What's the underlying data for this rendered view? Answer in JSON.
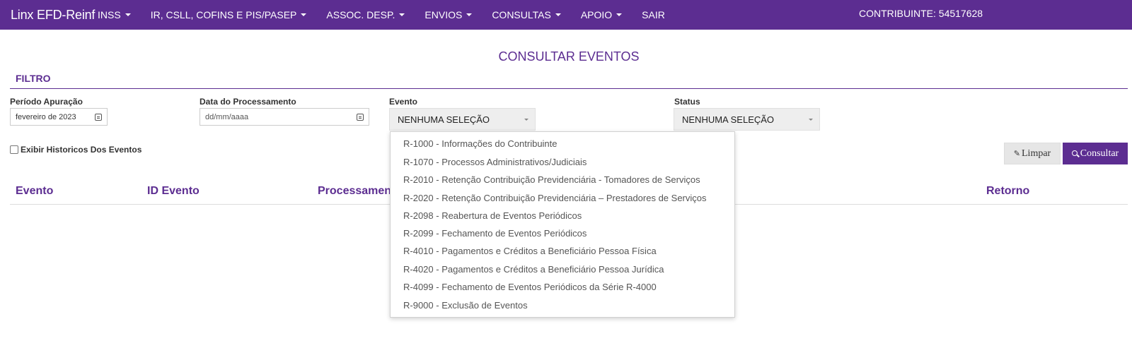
{
  "navbar": {
    "brand": "Linx EFD-Reinf",
    "menu": [
      {
        "label": "INSS"
      },
      {
        "label": "IR, CSLL, COFINS E PIS/PASEP"
      },
      {
        "label": "ASSOC. DESP."
      },
      {
        "label": "ENVIOS"
      },
      {
        "label": "CONSULTAS"
      },
      {
        "label": "APOIO"
      },
      {
        "label": "SAIR"
      }
    ],
    "contribuinte": "CONTRIBUINTE: 54517628"
  },
  "page": {
    "title": "CONSULTAR EVENTOS",
    "section_title": "FILTRO"
  },
  "filters": {
    "periodo": {
      "label": "Período Apuração",
      "value": "fevereiro de 2023"
    },
    "processamento": {
      "label": "Data do Processamento",
      "placeholder": "dd/mm/aaaa"
    },
    "evento": {
      "label": "Evento",
      "value": "NENHUMA SELEÇÃO"
    },
    "status": {
      "label": "Status",
      "value": "NENHUMA SELEÇÃO"
    },
    "historico_label": "Exibir Historicos Dos Eventos"
  },
  "buttons": {
    "limpar": "Limpar",
    "consultar": "Consultar"
  },
  "table": {
    "columns": [
      "Evento",
      "ID Evento",
      "Processamento",
      "Retorno"
    ]
  },
  "dropdown_options": [
    "R-1000 - Informações do Contribuinte",
    "R-1070 - Processos Administrativos/Judiciais",
    "R-2010 - Retenção Contribuição Previdenciária - Tomadores de Serviços",
    "R-2020 - Retenção Contribuição Previdenciária – Prestadores de Serviços",
    "R-2098 - Reabertura de Eventos Periódicos",
    "R-2099 - Fechamento de Eventos Periódicos",
    "R-4010 - Pagamentos e Créditos a Beneficiário Pessoa Física",
    "R-4020 - Pagamentos e Créditos a Beneficiário Pessoa Jurídica",
    "R-4099 - Fechamento de Eventos Periódicos da Série R-4000",
    "R-9000 - Exclusão de Eventos"
  ],
  "colors": {
    "brand": "#5c2d91",
    "select_bg": "#eeeeee"
  },
  "icons": {
    "calendar": "calendar-icon",
    "caret": "caret-down-icon",
    "pencil": "pencil-icon",
    "search": "search-icon"
  }
}
